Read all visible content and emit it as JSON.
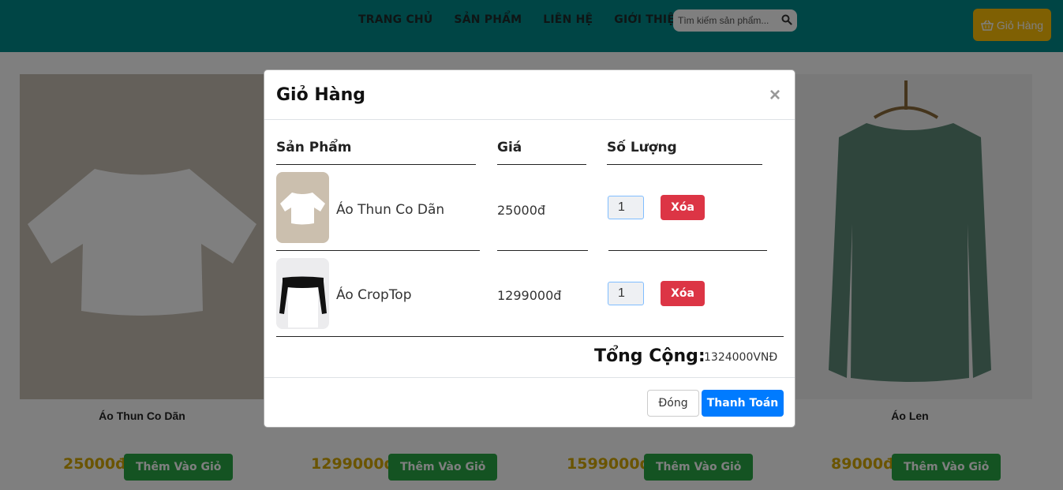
{
  "nav": {
    "items": [
      "TRANG CHỦ",
      "SẢN PHẨM",
      "LIÊN HỆ",
      "GIỚI THIỆU"
    ],
    "search_placeholder": "Tìm kiếm sản phẩm...",
    "cart_label": "Giỏ Hàng"
  },
  "products": [
    {
      "name": "Áo Thun Co Dãn",
      "price": "25000đ",
      "add_label": "Thêm Vào Giỏ"
    },
    {
      "name": "",
      "price": "1299000đ",
      "add_label": "Thêm Vào Giỏ"
    },
    {
      "name": "",
      "price": "1599000đ",
      "add_label": "Thêm Vào Giỏ"
    },
    {
      "name": "Áo Len",
      "price": "89000đ",
      "add_label": "Thêm Vào Giỏ"
    }
  ],
  "modal": {
    "title": "Giỏ Hàng",
    "close_symbol": "×",
    "headers": {
      "product": "Sản Phẩm",
      "price": "Giá",
      "qty": "Số Lượng"
    },
    "items": [
      {
        "name": "Áo Thun Co Dãn",
        "price": "25000đ",
        "qty": "1",
        "delete_label": "Xóa"
      },
      {
        "name": "Áo CropTop",
        "price": "1299000đ",
        "qty": "1",
        "delete_label": "Xóa"
      }
    ],
    "total_label": "Tổng Cộng:",
    "total_value": "1324000VNĐ",
    "close_button": "Đóng",
    "pay_button": "Thanh Toán"
  },
  "colors": {
    "header": "#008a8a",
    "cart": "#ffc107",
    "add": "#28a745",
    "delete": "#dc3545",
    "primary": "#007bff",
    "price": "#d4a800"
  }
}
